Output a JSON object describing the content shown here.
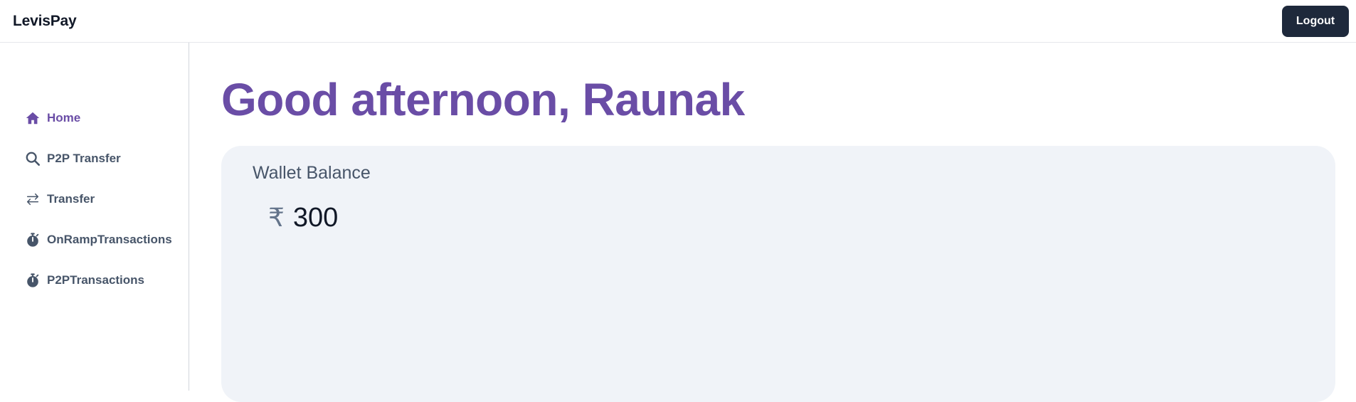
{
  "app": {
    "brand": "LevisPay"
  },
  "header": {
    "logout_label": "Logout"
  },
  "sidebar": {
    "items": [
      {
        "label": "Home",
        "icon": "home-icon",
        "active": true
      },
      {
        "label": "P2P Transfer",
        "icon": "search-icon",
        "active": false
      },
      {
        "label": "Transfer",
        "icon": "transfer-arrows-icon",
        "active": false
      },
      {
        "label": "OnRampTransactions",
        "icon": "stopwatch-icon",
        "active": false
      },
      {
        "label": "P2PTransactions",
        "icon": "stopwatch-icon",
        "active": false
      }
    ]
  },
  "main": {
    "greeting": "Good afternoon, Raunak",
    "wallet": {
      "title": "Wallet Balance",
      "currency_symbol": "₹",
      "amount": "300"
    }
  },
  "colors": {
    "accent": "#6a4da6",
    "nav_text": "#475569",
    "logout_bg": "#1e293b",
    "card_bg": "#f0f3f8"
  }
}
